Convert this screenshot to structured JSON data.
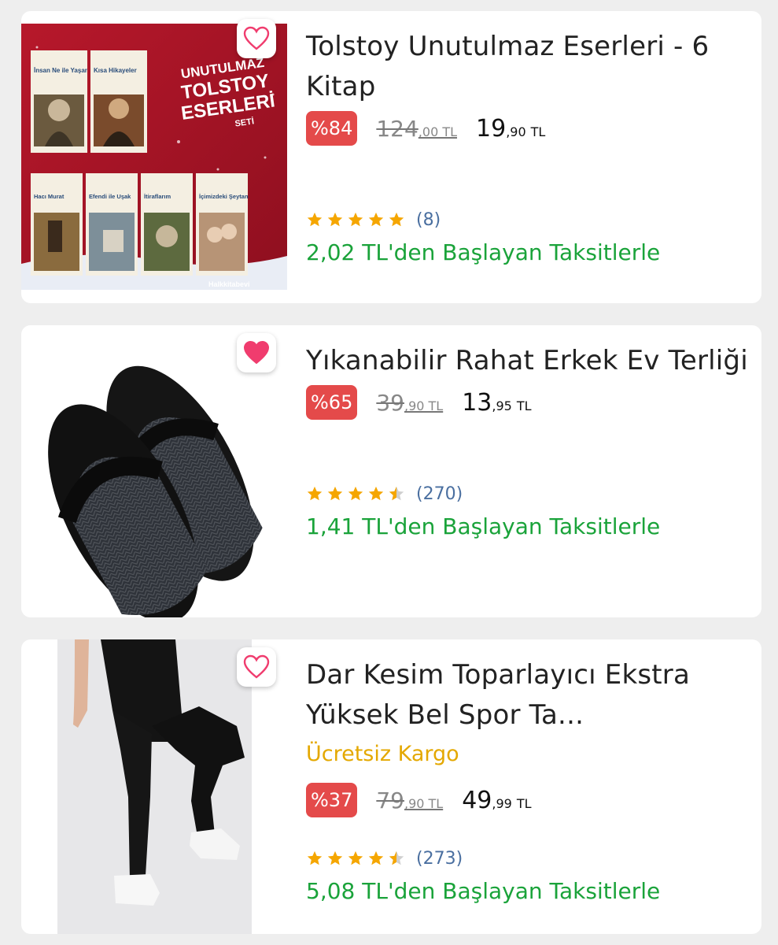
{
  "products": [
    {
      "title": "Tolstoy Unutulmaz Eserleri - 6 Kitap",
      "discount": "%84",
      "old_price_main": "124",
      "old_price_dec": ",00 TL",
      "new_price_main": "19",
      "new_price_dec": ",90",
      "currency": "TL",
      "rating_count": "(8)",
      "rating": 5,
      "installment": "2,02 TL'den Başlayan Taksitlerle",
      "favorited": false,
      "image": {
        "banner_line1": "UNUTULMAZ",
        "banner_line2": "TOLSTOY",
        "banner_line3": "ESERLERİ",
        "banner_line4": "SETİ",
        "book1": "İnsan Ne ile Yaşar",
        "book2": "Kısa Hikayeler",
        "book3": "Hacı Murat",
        "book4": "Efendi ile Uşak",
        "book5": "İtiraflarım",
        "book6": "İçimizdeki Şeytan",
        "publisher": "Halkkitabevi"
      }
    },
    {
      "title": "Yıkanabilir Rahat Erkek Ev Terliği",
      "discount": "%65",
      "old_price_main": "39",
      "old_price_dec": ",90 TL",
      "new_price_main": "13",
      "new_price_dec": ",95",
      "currency": "TL",
      "rating_count": "(270)",
      "rating": 4.5,
      "installment": "1,41 TL'den Başlayan Taksitlerle",
      "favorited": true
    },
    {
      "title": "Dar Kesim Toparlayıcı Ekstra Yüksek Bel Spor Ta...",
      "cargo": "Ücretsiz Kargo",
      "discount": "%37",
      "old_price_main": "79",
      "old_price_dec": ",90 TL",
      "new_price_main": "49",
      "new_price_dec": ",99",
      "currency": "TL",
      "rating_count": "(273)",
      "rating": 4.5,
      "installment": "5,08 TL'den Başlayan Taksitlerle",
      "favorited": false
    }
  ],
  "colors": {
    "discount_badge": "#e44a4a",
    "installment_text": "#1aa33a",
    "cargo_text": "#e4a800",
    "star": "#f5a600",
    "heart": "#f03c6e",
    "rating_count": "#4a6fa0"
  },
  "icons": {
    "favorite": "heart-icon",
    "rating": "star-icon"
  }
}
